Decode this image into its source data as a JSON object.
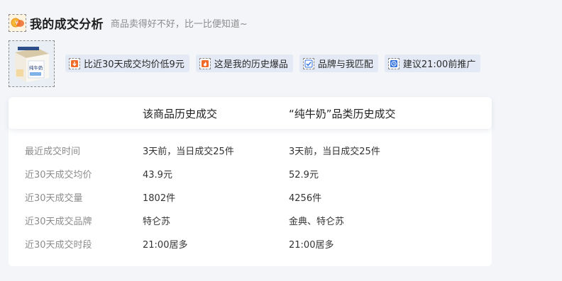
{
  "header": {
    "title": "我的成交分析",
    "subtitle": "商品卖得好不好，比一比便知道~"
  },
  "tags": [
    {
      "icon": "arrow-down-icon",
      "label": "比近30天成交均价低9元"
    },
    {
      "icon": "flame-icon",
      "label": "这是我的历史爆品"
    },
    {
      "icon": "checkmark-icon",
      "label": "品牌与我匹配"
    },
    {
      "icon": "clock-icon",
      "label": "建议21:00前推广"
    }
  ],
  "product_image": {
    "text": "纯牛奶"
  },
  "table": {
    "columns": [
      "该商品历史成交",
      "“纯牛奶”品类历史成交"
    ],
    "rows": [
      {
        "label": "最近成交时间",
        "item": "3天前，当日成交25件",
        "category": "3天前，当日成交25件"
      },
      {
        "label": "近30天成交均价",
        "item": "43.9元",
        "category": "52.9元"
      },
      {
        "label": "近30天成交量",
        "item": "1802件",
        "category": "4256件"
      },
      {
        "label": "近30天成交品牌",
        "item": "特仑苏",
        "category": "金典、特仑苏"
      },
      {
        "label": "近30天成交时段",
        "item": "21:00居多",
        "category": "21:00居多"
      }
    ]
  },
  "colors": {
    "background": "#f3f5f9",
    "tag_background": "#e3e9f5",
    "accent_orange": "#f06a2a",
    "accent_blue": "#2f6fe0"
  }
}
